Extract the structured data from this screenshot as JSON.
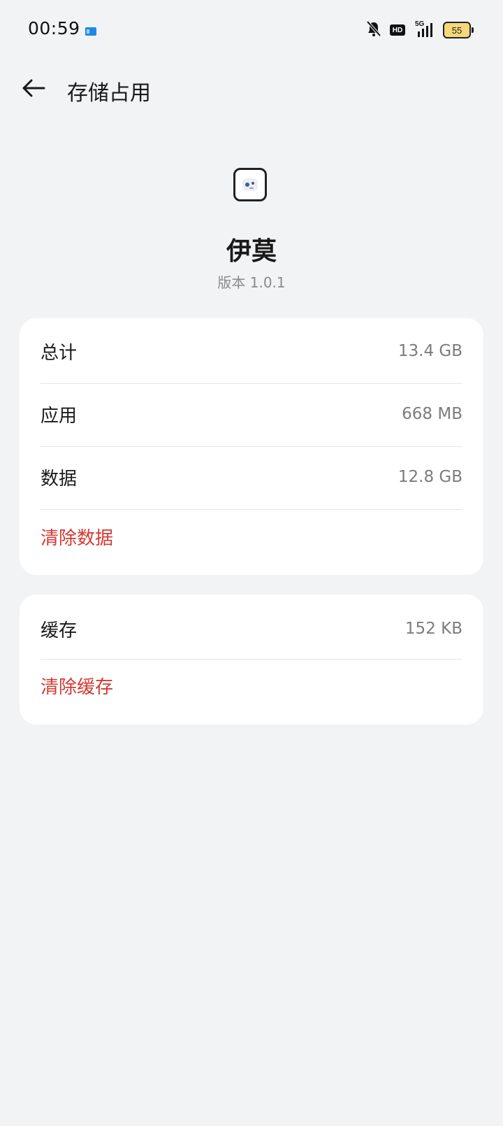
{
  "status_bar": {
    "time": "00:59",
    "network": "5G",
    "hd_label": "HD",
    "battery_level": "55",
    "icons": [
      "notification-app-icon",
      "bell-muted-icon",
      "hd-icon",
      "signal-5g-icon",
      "battery-icon"
    ]
  },
  "header": {
    "back_icon": "arrow-left-icon",
    "title": "存储占用"
  },
  "app": {
    "name": "伊莫",
    "version": "版本 1.0.1"
  },
  "storage": {
    "rows": [
      {
        "label": "总计",
        "value": "13.4 GB"
      },
      {
        "label": "应用",
        "value": "668 MB"
      },
      {
        "label": "数据",
        "value": "12.8 GB"
      }
    ],
    "action": "清除数据"
  },
  "cache": {
    "label": "缓存",
    "value": "152 KB",
    "action": "清除缓存"
  },
  "colors": {
    "background": "#f2f3f5",
    "card": "#ffffff",
    "danger": "#d33a31",
    "battery_fill": "#f6d77c"
  }
}
